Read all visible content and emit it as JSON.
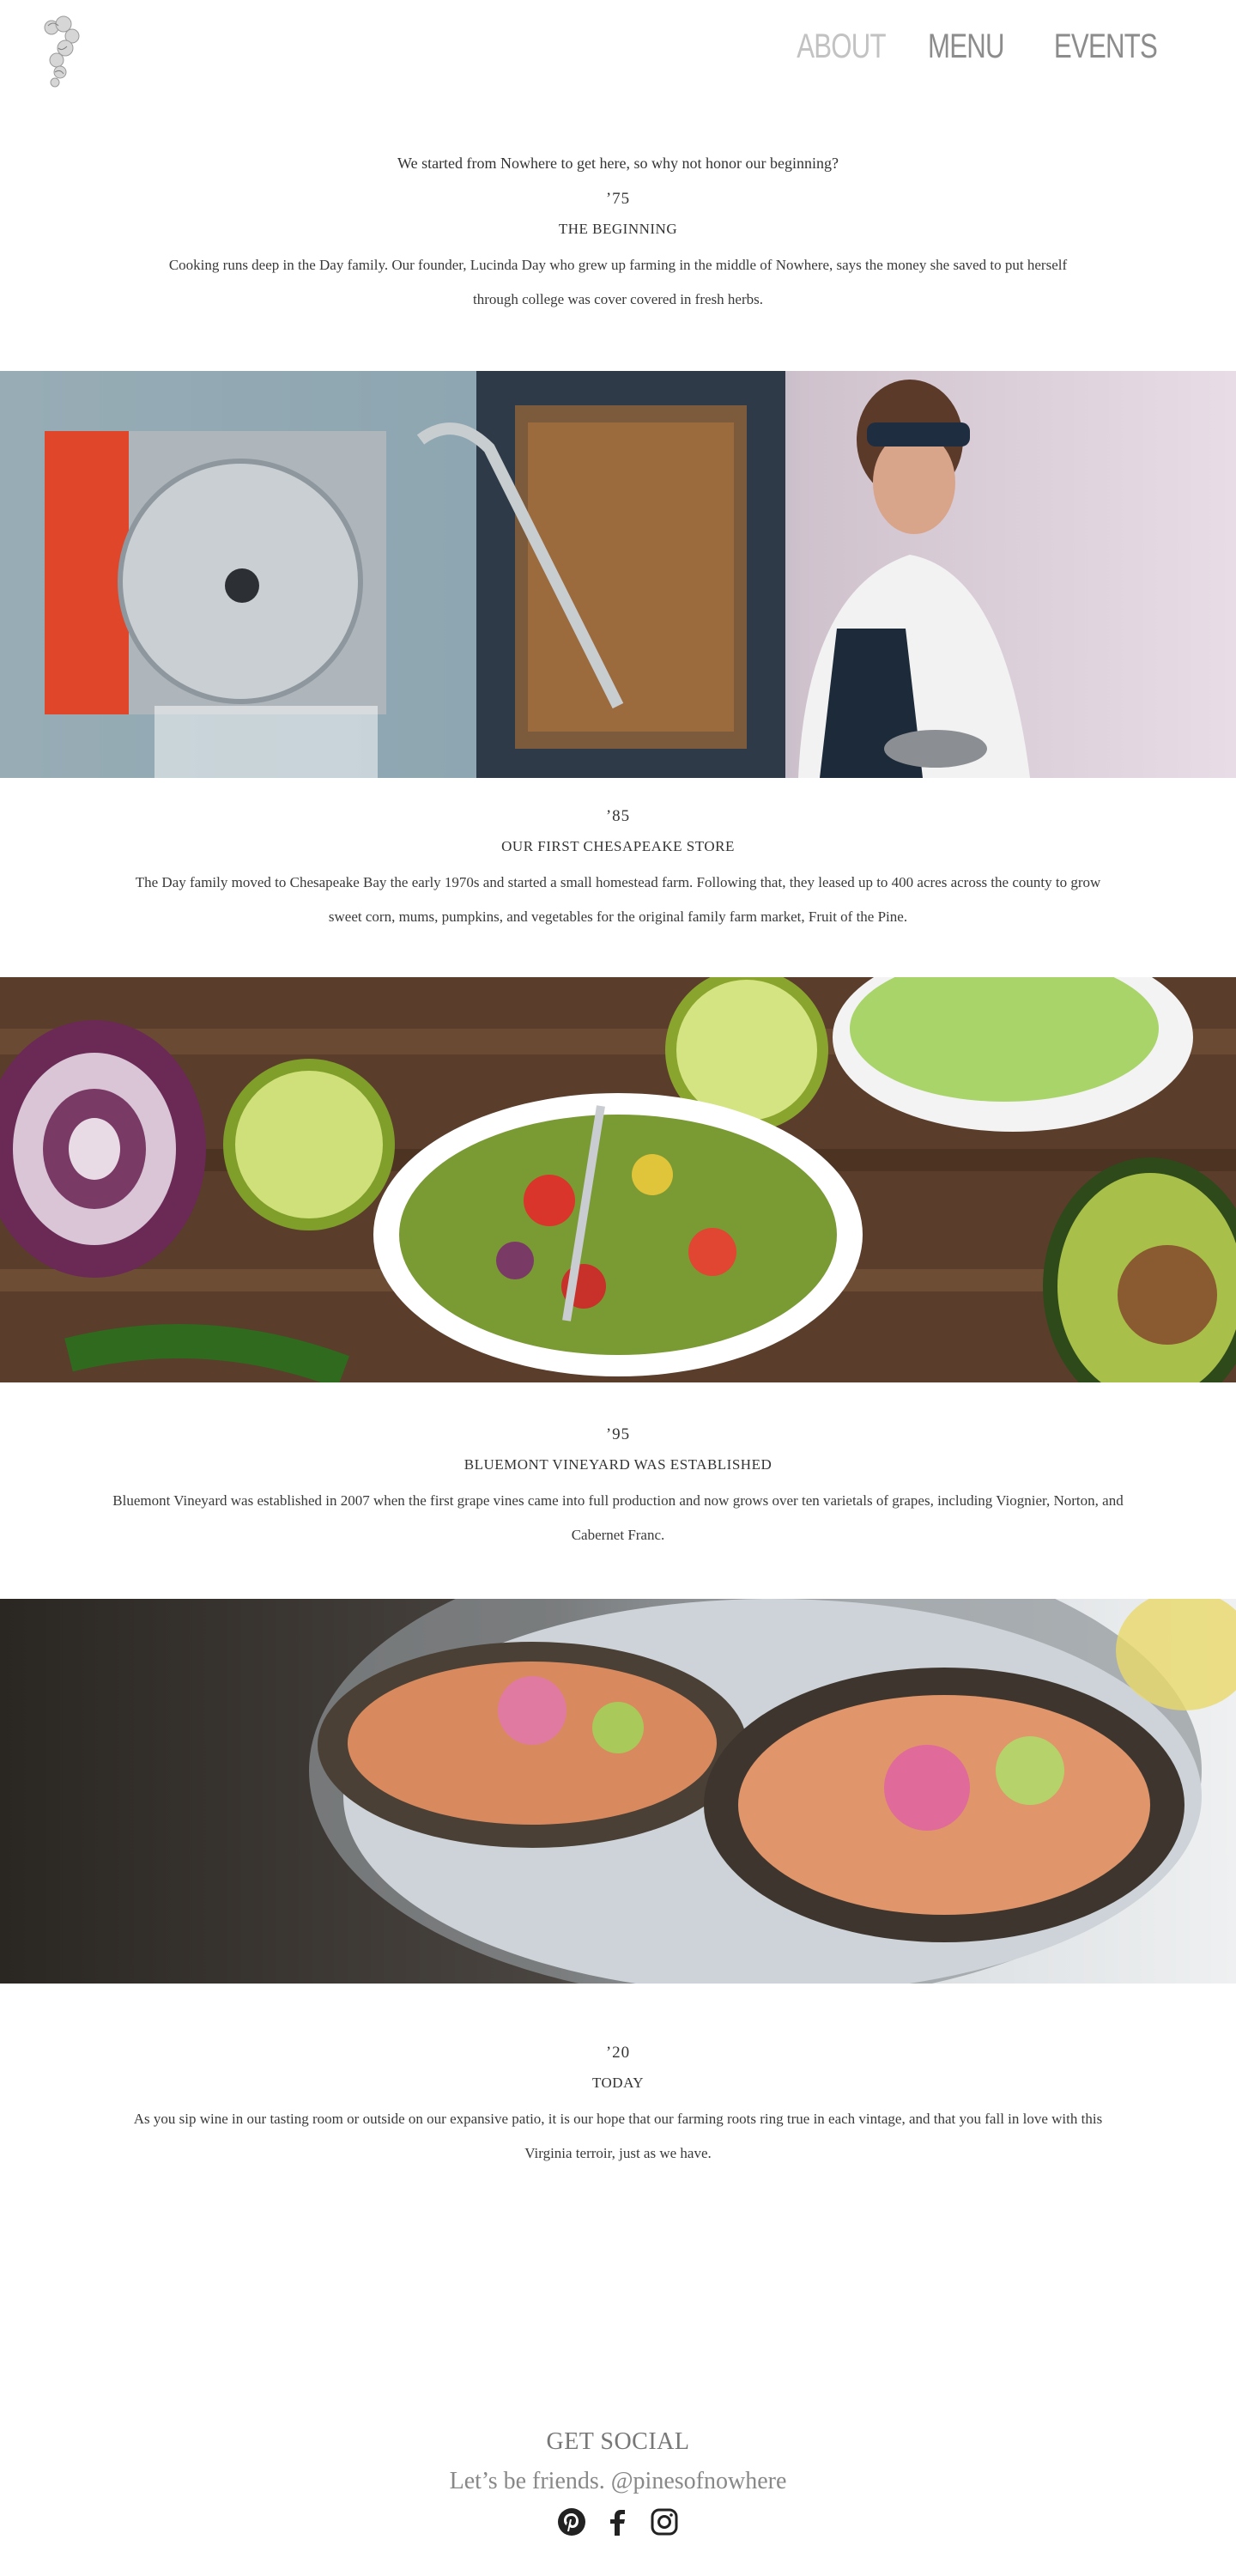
{
  "nav": {
    "items": [
      {
        "label": "ABOUT",
        "active": true
      },
      {
        "label": "MENU",
        "active": false
      },
      {
        "label": "EVENTS",
        "active": false
      }
    ]
  },
  "intro": {
    "tagline": "We started from Nowhere to get here, so why not honor our beginning?"
  },
  "sections": [
    {
      "year": "’75",
      "heading": "THE BEGINNING",
      "text": "Cooking runs deep in the Day family. Our founder, Lucinda Day who grew up farming in the middle of Nowhere, says the money she saved to put herself through college was cover covered in fresh herbs."
    },
    {
      "year": "’85",
      "heading": "OUR FIRST CHESAPEAKE STORE",
      "text": "The Day family moved to Chesapeake Bay the early 1970s and started a small homestead farm. Following that, they leased up to 400 acres across the county to grow sweet corn, mums, pumpkins, and vegetables for the original family farm market, Fruit of the Pine."
    },
    {
      "year": "’95",
      "heading": "BLUEMONT VINEYARD WAS ESTABLISHED",
      "text": "Bluemont Vineyard was established in 2007 when the first grape vines came into full production and now grows over ten varietals of grapes, including Viognier, Norton, and Cabernet Franc."
    },
    {
      "year": "’20",
      "heading": "TODAY",
      "text": "As you sip wine in our tasting room or outside on our expansive patio, it is our hope that our farming roots ring true in each vintage, and that you fall in love with this Virginia terroir, just as we have."
    }
  ],
  "footer": {
    "title": "GET SOCIAL",
    "subtitle": "Let’s be friends. @pinesofnowhere",
    "icons": [
      "pinterest-icon",
      "facebook-icon",
      "instagram-icon"
    ]
  },
  "colors": {
    "nav_active": "#c2c2c2",
    "nav_inactive": "#8c8c8c",
    "text": "#2b2b2b"
  }
}
